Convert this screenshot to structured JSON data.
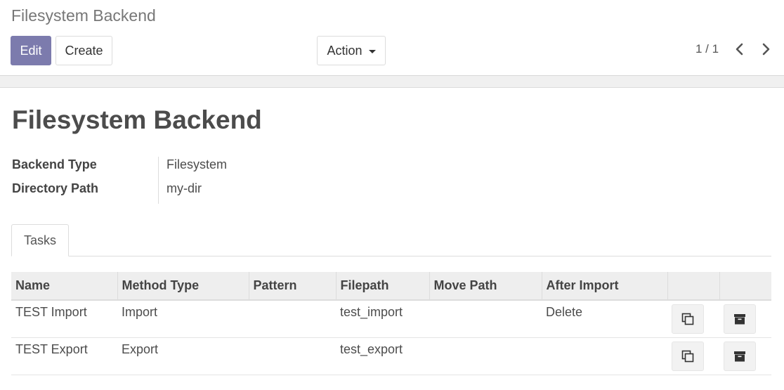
{
  "control_panel": {
    "breadcrumb": "Filesystem Backend",
    "edit_label": "Edit",
    "create_label": "Create",
    "action_label": "Action",
    "pager_value": "1 / 1"
  },
  "record": {
    "title": "Filesystem Backend",
    "fields": [
      {
        "label": "Backend Type",
        "value": "Filesystem"
      },
      {
        "label": "Directory Path",
        "value": "my-dir"
      }
    ]
  },
  "tabs": [
    {
      "label": "Tasks"
    }
  ],
  "tasks_table": {
    "columns": [
      "Name",
      "Method Type",
      "Pattern",
      "Filepath",
      "Move Path",
      "After Import",
      "",
      ""
    ],
    "rows": [
      {
        "name": "TEST Import",
        "method_type": "Import",
        "pattern": "",
        "filepath": "test_import",
        "move_path": "",
        "after_import": "Delete"
      },
      {
        "name": "TEST Export",
        "method_type": "Export",
        "pattern": "",
        "filepath": "test_export",
        "move_path": "",
        "after_import": ""
      }
    ]
  },
  "icons": {
    "copy": "copy-icon",
    "archive": "archive-icon",
    "prev": "chevron-left-icon",
    "next": "chevron-right-icon"
  },
  "colors": {
    "primary": "#7c7bad"
  }
}
